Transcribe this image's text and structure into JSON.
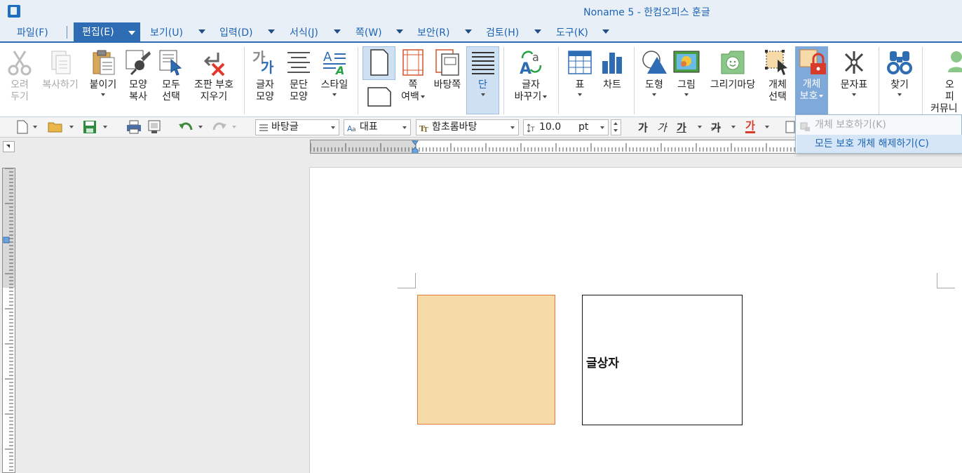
{
  "titlebar": {
    "title": "Noname 5 - 한컴오피스 훈글"
  },
  "menus": [
    {
      "label": "파일(F)"
    },
    {
      "label": "편집(E)",
      "active": true
    },
    {
      "label": "보기(U)"
    },
    {
      "label": "입력(D)"
    },
    {
      "label": "서식(J)"
    },
    {
      "label": "쪽(W)"
    },
    {
      "label": "보안(R)"
    },
    {
      "label": "검토(H)"
    },
    {
      "label": "도구(K)"
    }
  ],
  "ribbon": {
    "cut": {
      "line1": "오려",
      "line2": "두기"
    },
    "copy": {
      "label": "복사하기"
    },
    "paste": {
      "label": "붙이기"
    },
    "format_painter": {
      "line1": "모양",
      "line2": "복사"
    },
    "select_all": {
      "line1": "모두",
      "line2": "선택"
    },
    "remove_marks": {
      "line1": "조판 부호",
      "line2": "지우기"
    },
    "char_shape": {
      "line1": "글자",
      "line2": "모양"
    },
    "para_shape": {
      "line1": "문단",
      "line2": "모양"
    },
    "style": {
      "label": "스타일"
    },
    "page_margin": {
      "line1": "쪽",
      "line2": "여백"
    },
    "master_page": {
      "label": "바탕쪽"
    },
    "columns": {
      "label": "단"
    },
    "char_replace": {
      "line1": "글자",
      "line2": "바꾸기"
    },
    "table": {
      "label": "표"
    },
    "chart": {
      "label": "차트"
    },
    "shapes": {
      "label": "도형"
    },
    "picture": {
      "label": "그림"
    },
    "drawing": {
      "label": "그리기마당"
    },
    "object_select": {
      "line1": "개체",
      "line2": "선택"
    },
    "object_protect": {
      "line1": "개체",
      "line2": "보호"
    },
    "char_map": {
      "label": "문자표"
    },
    "find": {
      "label": "찾기"
    },
    "office_community": {
      "line1": "오피",
      "line2": "커뮤니"
    }
  },
  "toolbar": {
    "style_value": "바탕글",
    "font_lang_value": "대표",
    "font_value": "함초롬바탕",
    "size_value": "10.0",
    "size_unit": "pt",
    "bold": "가",
    "italic": "가",
    "underline": "가",
    "strike": "가",
    "color": "가"
  },
  "popup": {
    "items": [
      {
        "label": "개체 보호하기(K)"
      },
      {
        "label": "모든 보호 개체 해제하기(C)"
      }
    ]
  },
  "document": {
    "textbox_text": "글상자",
    "shape_fill": "#f6dba9",
    "shape_border": "#e07a3e"
  },
  "colors": {
    "accent": "#2e6db4",
    "title_text": "#1b63b5"
  }
}
